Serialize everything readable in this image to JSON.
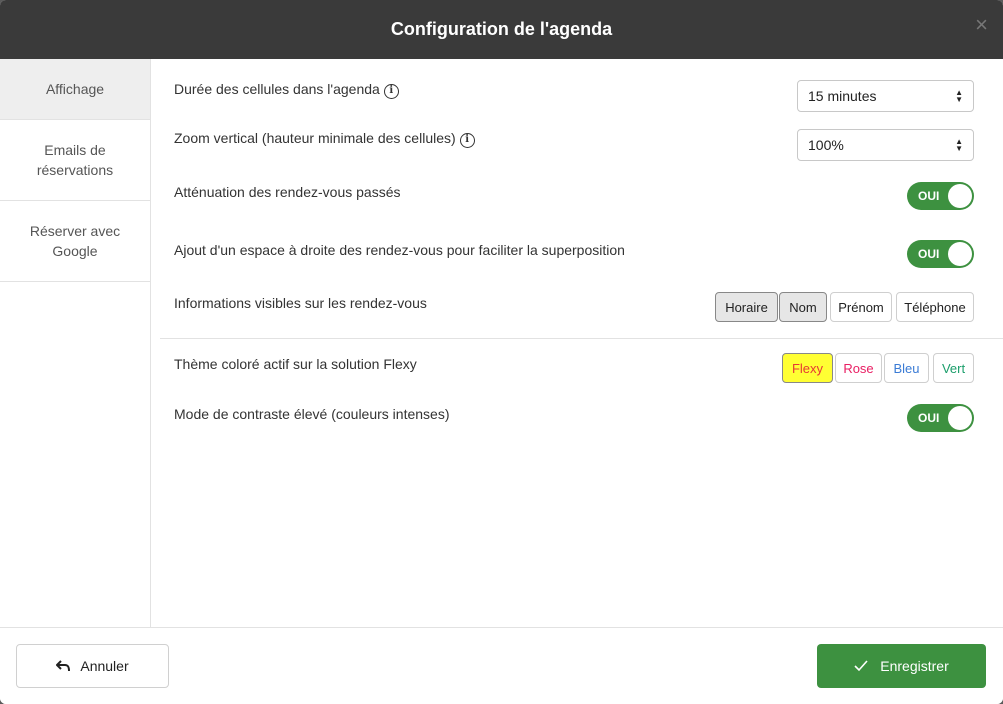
{
  "header": {
    "title": "Configuration de l'agenda",
    "close": "×"
  },
  "sidebar": {
    "items": [
      {
        "label": "Affichage"
      },
      {
        "label": "Emails de\nréservations"
      },
      {
        "label": "Réserver avec\nGoogle"
      }
    ]
  },
  "settings": {
    "cell_duration": {
      "label": "Durée des cellules dans l'agenda",
      "value": "15 minutes"
    },
    "vertical_zoom": {
      "label": "Zoom vertical (hauteur minimale des cellules)",
      "value": "100%"
    },
    "attenuation": {
      "label": "Atténuation des rendez-vous passés",
      "toggle": "OUI"
    },
    "right_space": {
      "label": "Ajout d'un espace à droite des rendez-vous pour faciliter la superposition",
      "toggle": "OUI"
    },
    "visible_info": {
      "label": "Informations visibles sur les rendez-vous",
      "options": [
        {
          "label": "Horaire",
          "selected": true
        },
        {
          "label": "Nom",
          "selected": true
        },
        {
          "label": "Prénom",
          "selected": false
        },
        {
          "label": "Téléphone",
          "selected": false
        }
      ]
    },
    "theme": {
      "label": "Thème coloré actif sur la solution Flexy",
      "options": [
        {
          "label": "Flexy",
          "color": "#e53935",
          "bg": "#ffff33"
        },
        {
          "label": "Rose",
          "color": "#e91e63"
        },
        {
          "label": "Bleu",
          "color": "#3a7bd5"
        },
        {
          "label": "Vert",
          "color": "#1b9e6b"
        }
      ]
    },
    "high_contrast": {
      "label": "Mode de contraste élevé (couleurs intenses)",
      "toggle": "OUI"
    }
  },
  "footer": {
    "cancel_label": "Annuler",
    "save_label": "Enregistrer"
  },
  "colors": {
    "primary": "#3d9140",
    "header_bg": "#3a3a3a"
  }
}
